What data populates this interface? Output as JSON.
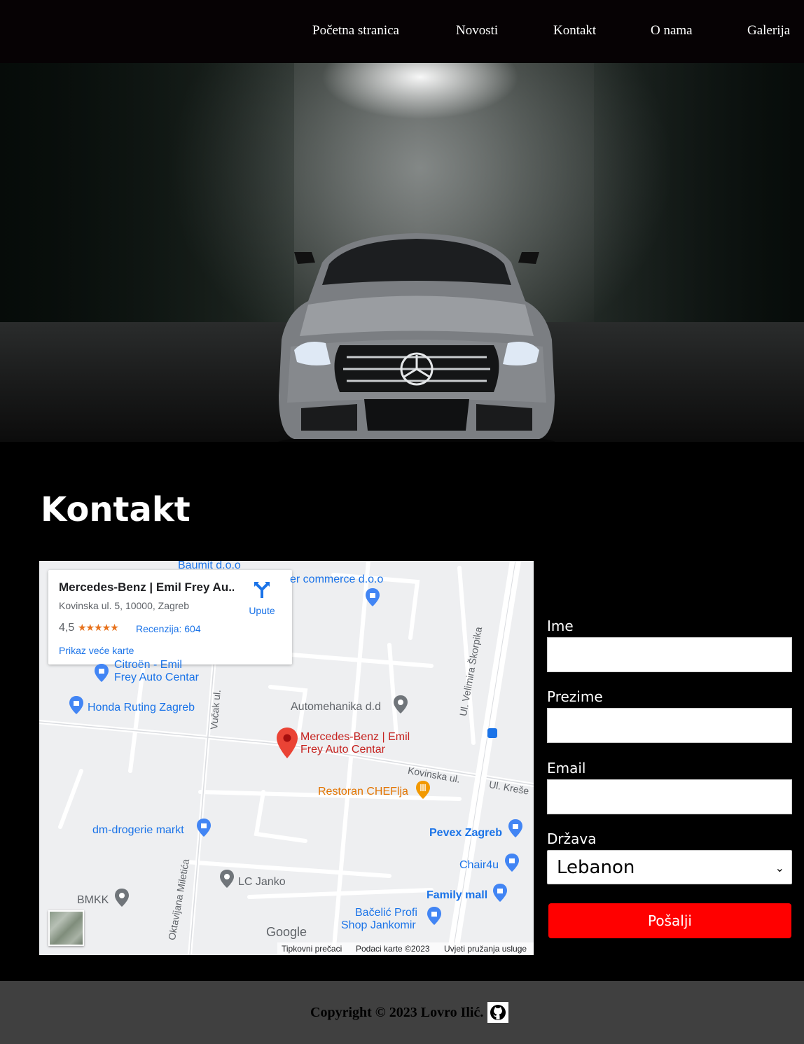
{
  "nav": {
    "items": [
      {
        "label": "Početna stranica"
      },
      {
        "label": "Novosti"
      },
      {
        "label": "Kontakt"
      },
      {
        "label": "O nama"
      },
      {
        "label": "Galerija"
      }
    ]
  },
  "contact": {
    "title": "Kontakt"
  },
  "map": {
    "card": {
      "title": "Mercedes-Benz | Emil Frey Au...",
      "address": "Kovinska ul. 5, 10000, Zagreb",
      "rating": "4,5",
      "stars": "★★★★★",
      "reviews": "Recenzija: 604",
      "bigger_map": "Prikaz veće karte",
      "directions": "Upute"
    },
    "places": {
      "baumit": "Baumit d.o.o",
      "commerce": "er commerce d.o.o",
      "citroen_1": "Citroën - Emil",
      "citroen_2": "Frey Auto Centar",
      "honda": "Honda Ruting Zagreb",
      "automehanika": "Automehanika d.d",
      "mercedes_1": "Mercedes-Benz | Emil",
      "mercedes_2": "Frey Auto Centar",
      "chefflja": "Restoran CHEFlja",
      "dm": "dm-drogerie markt",
      "pevex": "Pevex Zagreb",
      "chair4u": "Chair4u",
      "lc_janko": "LC Janko",
      "family_mall": "Family mall",
      "bmkk": "BMKK",
      "bacelic_1": "Bačelić Profi",
      "bacelic_2": "Shop Jankomir"
    },
    "streets": {
      "skorpika": "Ul. Velimira Škorpika",
      "vucak": "Vučak ul.",
      "kovinska": "Kovinska ul.",
      "kreše": "Ul. Kreše",
      "miletica": "Oktavijana Miletića"
    },
    "footer": {
      "shortcuts": "Tipkovni prečaci",
      "mapdata": "Podaci karte ©2023",
      "terms": "Uvjeti pružanja usluge"
    },
    "logo": "Google"
  },
  "form": {
    "first_name_label": "Ime",
    "last_name_label": "Prezime",
    "email_label": "Email",
    "country_label": "Država",
    "country_value": "Lebanon",
    "submit_label": "Pošalji"
  },
  "footer": {
    "copyright": "Copyright © 2023 Lovro Ilić."
  },
  "colors": {
    "nav_bg": "#060204",
    "page_bg": "#000000",
    "submit": "#ff0000",
    "footer_bg": "#404040",
    "map_blue": "#1a73e8",
    "map_pin_red": "#ea4335"
  }
}
